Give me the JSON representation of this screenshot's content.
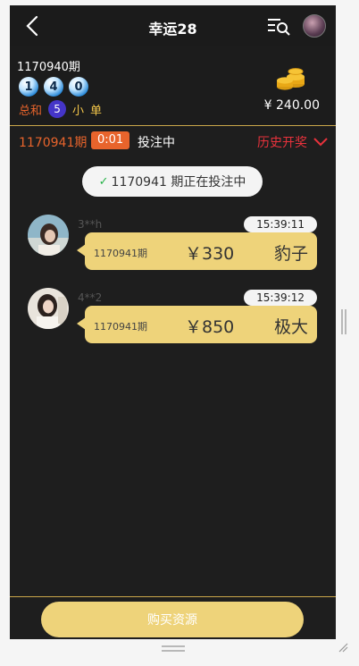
{
  "header": {
    "title": "幸运28",
    "back_icon": "chevron-left-icon",
    "menu_icon": "list-search-icon"
  },
  "last_draw": {
    "issue": "1170940期",
    "balls": [
      "1",
      "4",
      "0"
    ],
    "sum_label": "总和",
    "sum_value": "5",
    "size_tag": "小",
    "parity_tag": "单",
    "balance": "¥ 240.00"
  },
  "current": {
    "issue": "1170941期",
    "countdown": "0:01",
    "status": "投注中",
    "history_label": "历史开奖"
  },
  "notice": {
    "check": "✓",
    "text": "1170941 期正在投注中"
  },
  "bets": [
    {
      "user": "3**h",
      "time": "15:39:11",
      "issue": "1170941期",
      "amount": "￥330",
      "type": "豹子"
    },
    {
      "user": "4**2",
      "time": "15:39:12",
      "issue": "1170941期",
      "amount": "￥850",
      "type": "极大"
    }
  ],
  "footer": {
    "buy_label": "购买资源"
  },
  "colors": {
    "gold": "#eed37a",
    "orange": "#e8642c",
    "red": "#e8323c",
    "bg": "#1e1e1e"
  }
}
